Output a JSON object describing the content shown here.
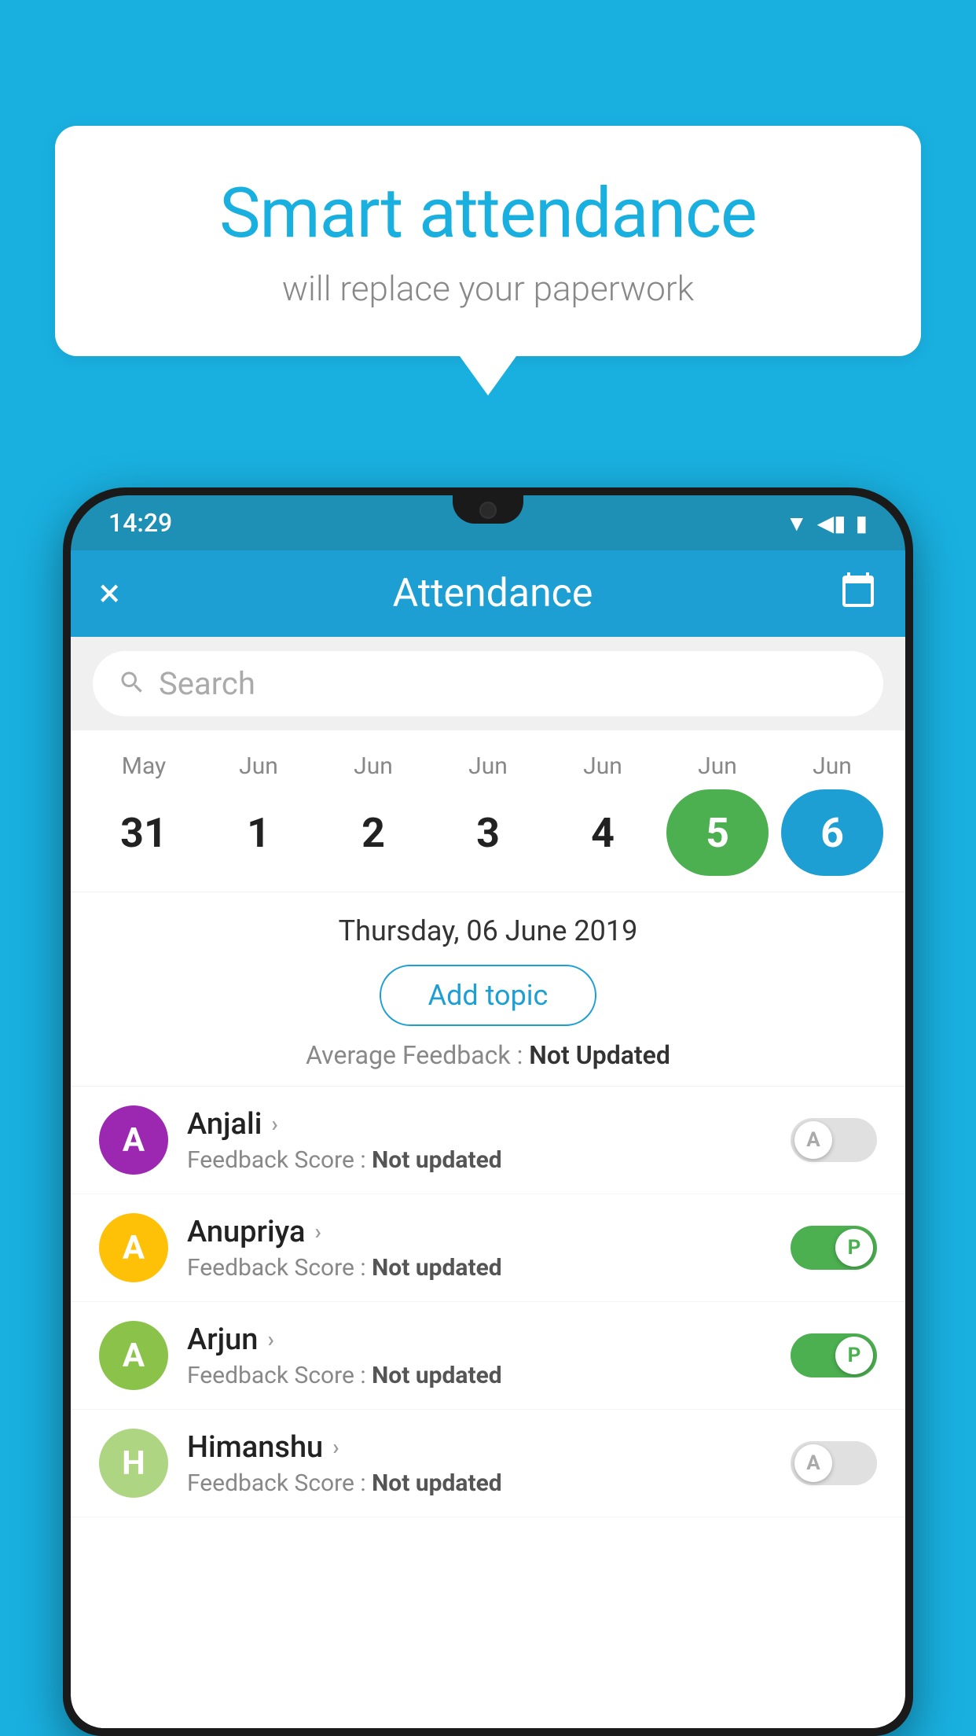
{
  "background_color": "#19b0e0",
  "bubble": {
    "title": "Smart attendance",
    "subtitle": "will replace your paperwork"
  },
  "status_bar": {
    "time": "14:29",
    "wifi": "▼",
    "signal": "◀",
    "battery": "▮"
  },
  "app_bar": {
    "title": "Attendance",
    "close_label": "×",
    "calendar_label": "📅"
  },
  "search": {
    "placeholder": "Search"
  },
  "calendar": {
    "months": [
      "May",
      "Jun",
      "Jun",
      "Jun",
      "Jun",
      "Jun",
      "Jun"
    ],
    "dates": [
      "31",
      "1",
      "2",
      "3",
      "4",
      "5",
      "6"
    ],
    "states": [
      "normal",
      "normal",
      "normal",
      "normal",
      "normal",
      "today",
      "selected"
    ]
  },
  "selected_date": {
    "full_text": "Thursday, 06 June 2019",
    "add_topic_label": "Add topic",
    "avg_feedback_label": "Average Feedback :",
    "avg_feedback_value": "Not Updated"
  },
  "students": [
    {
      "name": "Anjali",
      "avatar_letter": "A",
      "avatar_color": "#9c27b0",
      "feedback_label": "Feedback Score :",
      "feedback_value": "Not updated",
      "toggle_state": "off",
      "toggle_letter": "A"
    },
    {
      "name": "Anupriya",
      "avatar_letter": "A",
      "avatar_color": "#ffc107",
      "feedback_label": "Feedback Score :",
      "feedback_value": "Not updated",
      "toggle_state": "on",
      "toggle_letter": "P"
    },
    {
      "name": "Arjun",
      "avatar_letter": "A",
      "avatar_color": "#8bc34a",
      "feedback_label": "Feedback Score :",
      "feedback_value": "Not updated",
      "toggle_state": "on",
      "toggle_letter": "P"
    },
    {
      "name": "Himanshu",
      "avatar_letter": "H",
      "avatar_color": "#aed581",
      "feedback_label": "Feedback Score :",
      "feedback_value": "Not updated",
      "toggle_state": "off",
      "toggle_letter": "A"
    }
  ]
}
